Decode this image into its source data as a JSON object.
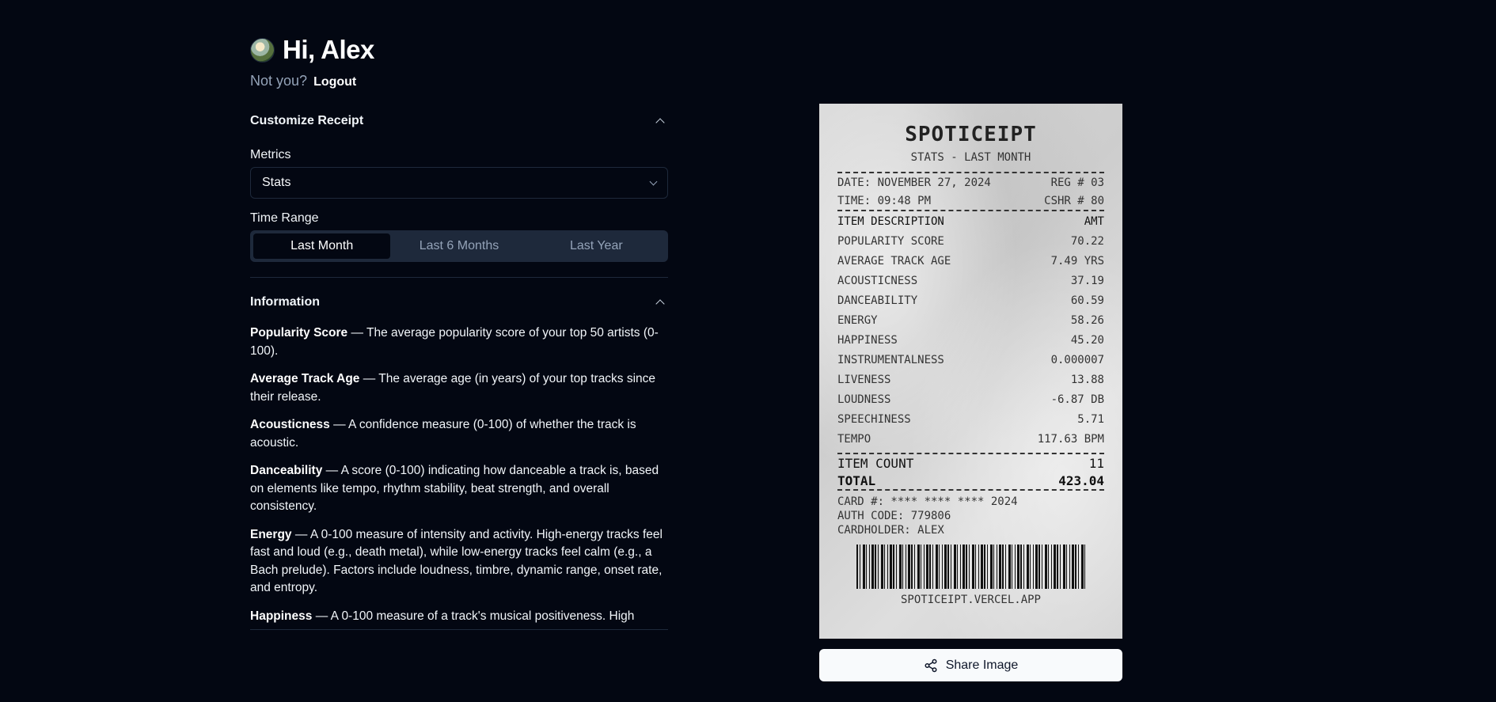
{
  "user": {
    "greeting": "Hi, Alex",
    "not_you": "Not you?",
    "logout": "Logout"
  },
  "customize": {
    "title": "Customize Receipt",
    "metrics_label": "Metrics",
    "metrics_value": "Stats",
    "time_range_label": "Time Range",
    "time_ranges": [
      "Last Month",
      "Last 6 Months",
      "Last Year"
    ],
    "selected_time_range": "Last Month"
  },
  "information": {
    "title": "Information",
    "items": [
      {
        "term": "Popularity Score",
        "desc": " — The average popularity score of your top 50 artists (0-100)."
      },
      {
        "term": "Average Track Age",
        "desc": " — The average age (in years) of your top tracks since their release."
      },
      {
        "term": "Acousticness",
        "desc": " — A confidence measure (0-100) of whether the track is acoustic."
      },
      {
        "term": "Danceability",
        "desc": " — A score (0-100) indicating how danceable a track is, based on elements like tempo, rhythm stability, beat strength, and overall consistency."
      },
      {
        "term": "Energy",
        "desc": " — A 0-100 measure of intensity and activity. High-energy tracks feel fast and loud (e.g., death metal), while low-energy tracks feel calm (e.g., a Bach prelude). Factors include loudness, timbre, dynamic range, onset rate, and entropy."
      },
      {
        "term": "Happiness",
        "desc": " — A 0-100 measure of a track's musical positiveness. High"
      }
    ]
  },
  "receipt": {
    "title": "SPOTICEIPT",
    "subtitle": "STATS - LAST MONTH",
    "date": "DATE: NOVEMBER 27, 2024",
    "reg": "REG # 03",
    "time": "TIME: 09:48 PM",
    "cshr": "CSHR # 80",
    "header_desc": "ITEM DESCRIPTION",
    "header_amt": "AMT",
    "items": [
      {
        "name": "POPULARITY SCORE",
        "value": "70.22"
      },
      {
        "name": "AVERAGE TRACK AGE",
        "value": "7.49 YRS"
      },
      {
        "name": "ACOUSTICNESS",
        "value": "37.19"
      },
      {
        "name": "DANCEABILITY",
        "value": "60.59"
      },
      {
        "name": "ENERGY",
        "value": "58.26"
      },
      {
        "name": "HAPPINESS",
        "value": "45.20"
      },
      {
        "name": "INSTRUMENTALNESS",
        "value": "0.000007"
      },
      {
        "name": "LIVENESS",
        "value": "13.88"
      },
      {
        "name": "LOUDNESS",
        "value": "-6.87 DB"
      },
      {
        "name": "SPEECHINESS",
        "value": "5.71"
      },
      {
        "name": "TEMPO",
        "value": "117.63 BPM"
      }
    ],
    "item_count_label": "ITEM COUNT",
    "item_count": "11",
    "total_label": "TOTAL",
    "total": "423.04",
    "card": "CARD #: **** **** **** 2024",
    "auth": "AUTH CODE: 779806",
    "cardholder": "CARDHOLDER: ALEX",
    "url": "SPOTICEIPT.VERCEL.APP"
  },
  "share_button": "Share Image",
  "icons": {
    "avatar": "avatar-image",
    "collapse": "chevron-up-icon",
    "dropdown": "chevron-down-icon",
    "share": "share-icon"
  }
}
